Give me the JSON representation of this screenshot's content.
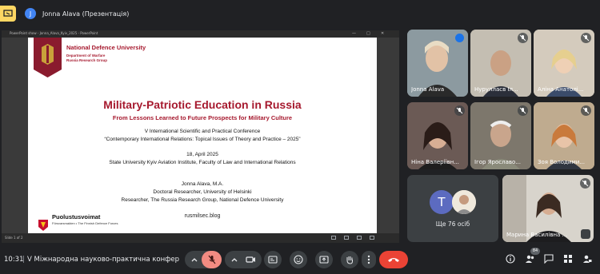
{
  "presenter": {
    "avatar_letter": "J",
    "label": "Jonna Alava (Презентація)"
  },
  "pres_window": {
    "title": "PowerPoint show - Jonna_Alava_Kyiv_2025 - PowerPoint",
    "status": "Slide 1 of 2"
  },
  "slide": {
    "university": "National Defence University",
    "department_line1": "Department of Warfare",
    "department_line2": "Russia Research Group",
    "title": "Military-Patriotic Education in Russia",
    "subtitle": "From Lessons Learned to Future Prospects for Military Culture",
    "conference_line1": "V International Scientific and Practical Conference",
    "conference_line2": "“Contemporary International Relations: Topical Issues of Theory and Practice – 2025”",
    "date": "18, April 2025",
    "venue": "State University Kyiv Aviation Institute, Faculty of Law and International Relations",
    "author": "Jonna Alava, M.A.",
    "author_role1": "Doctoral Researcher, University of Helsinki",
    "author_role2": "Researcher, The Russia Research Group, National Defence University",
    "blog": "rusmilsec.blog",
    "footer_org": "Puolustusvoimat",
    "footer_org_sub": "Försvarsmakten • The Finnish Defence Forces"
  },
  "participants": [
    {
      "name": "Jonna Alava",
      "muted": false,
      "speaking": true
    },
    {
      "name": "Нурулласв Іл...",
      "muted": true
    },
    {
      "name": "Аліна Анатолі...",
      "muted": true
    },
    {
      "name": "Ніна Валеріївн...",
      "muted": true
    },
    {
      "name": "Ігор Ярославо...",
      "muted": true
    },
    {
      "name": "Зоя Володими...",
      "muted": true
    },
    {
      "name": "Марина Василівна ...",
      "muted": true
    }
  ],
  "more_tile": {
    "avatar_letter": "T",
    "label": "Ще 76 осіб"
  },
  "bottom": {
    "time": "10:31",
    "separator": "|",
    "meeting_title": "V Міжнародна науково-практична конференція...",
    "participant_count": "84"
  },
  "colors": {
    "background": "#202124",
    "slide_accent": "#a6192e",
    "end_call": "#ea4335",
    "mic_off_active": "#f28b82",
    "presenting": "#fdd663"
  },
  "icons": [
    "present-to-all-icon",
    "chevron-up-icon",
    "mic-off-icon",
    "camera-icon",
    "captions-icon",
    "emoji-icon",
    "present-icon",
    "hand-icon",
    "more-icon",
    "call-end-icon",
    "info-icon",
    "people-icon",
    "chat-icon",
    "activities-icon",
    "lock-person-icon"
  ]
}
